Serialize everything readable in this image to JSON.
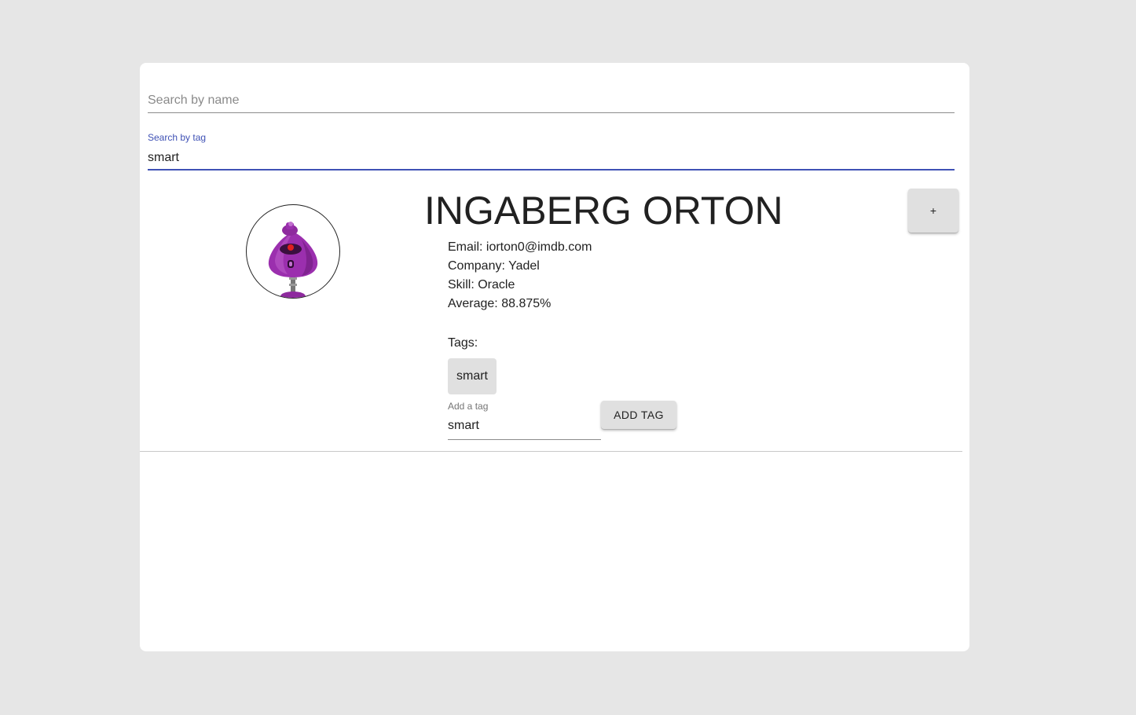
{
  "search": {
    "name_placeholder": "Search by name",
    "name_value": "",
    "tag_label": "Search by tag",
    "tag_value": "smart"
  },
  "student": {
    "name": "INGABERG ORTON",
    "expand_label": "+",
    "details": [
      "Email: iorton0@imdb.com",
      "Company: Yadel",
      "Skill: Oracle",
      "Average: 88.875%"
    ],
    "tags_label": "Tags:",
    "tags": [
      "smart"
    ],
    "add_tag": {
      "label": "Add a tag",
      "value": "smart",
      "button_label": "ADD TAG"
    },
    "avatar_icon": "robot-avatar"
  },
  "colors": {
    "background": "#e6e6e6",
    "card": "#ffffff",
    "accent": "#3f51b5",
    "button": "#e0e0e0",
    "avatar_purple": "#8e2a9e"
  }
}
